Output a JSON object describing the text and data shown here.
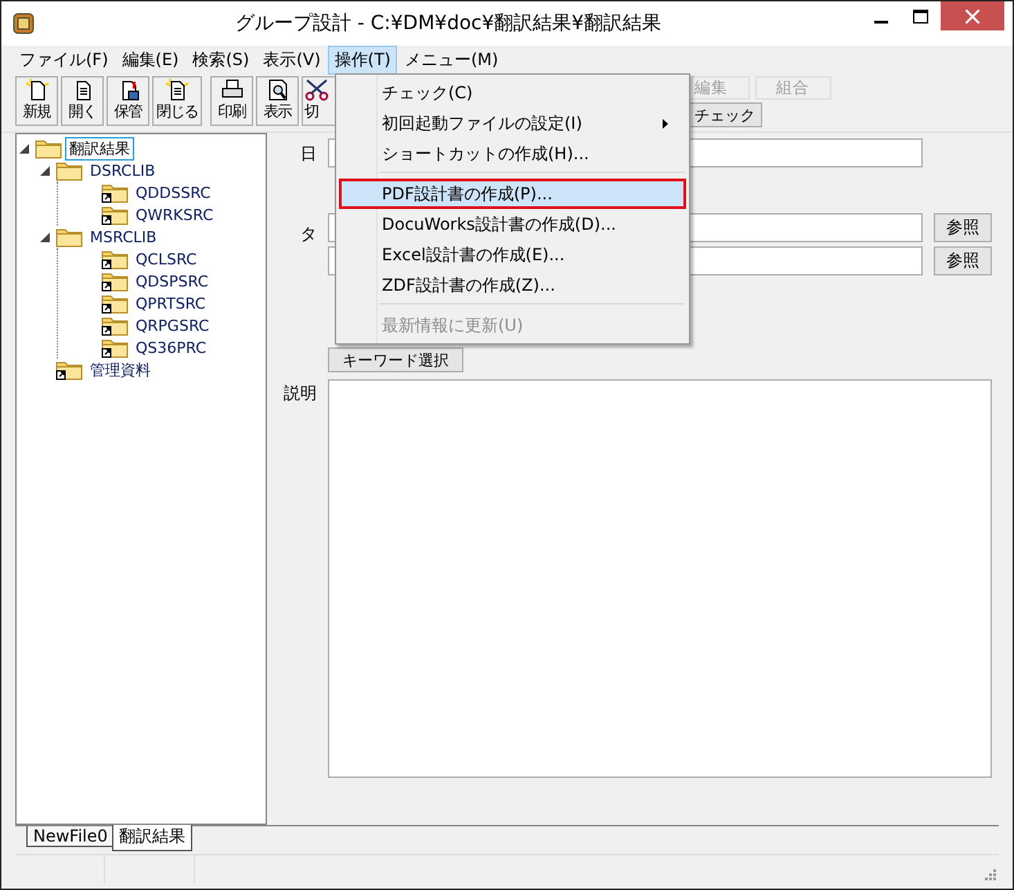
{
  "window": {
    "title": "グループ設計 - C:¥DM¥doc¥翻訳結果¥翻訳結果"
  },
  "menubar": [
    {
      "label": "ファイル(F)",
      "selected": false
    },
    {
      "label": "編集(E)",
      "selected": false
    },
    {
      "label": "検索(S)",
      "selected": false
    },
    {
      "label": "表示(V)",
      "selected": false
    },
    {
      "label": "操作(T)",
      "selected": true
    },
    {
      "label": "メニュー(M)",
      "selected": false
    }
  ],
  "toolbar": [
    {
      "label": "新規",
      "kind": "new"
    },
    {
      "label": "開く",
      "kind": "open"
    },
    {
      "label": "保管",
      "kind": "save"
    },
    {
      "label": "閉じる",
      "kind": "close"
    },
    {
      "label": "印刷",
      "kind": "print"
    },
    {
      "label": "表示",
      "kind": "view"
    },
    {
      "label": "切",
      "kind": "cut"
    }
  ],
  "toolbar_right": [
    {
      "label": "編集",
      "disabled": true
    },
    {
      "label": "組合",
      "disabled": true
    }
  ],
  "check_button": "チェック",
  "tree": [
    {
      "label": "翻訳結果",
      "selected": true,
      "kind": "folder",
      "expanded": true,
      "children": [
        {
          "label": "DSRCLIB",
          "selected": false,
          "kind": "folder",
          "expanded": true,
          "children": [
            {
              "label": "QDDSSRC",
              "selected": false,
              "kind": "link"
            },
            {
              "label": "QWRKSRC",
              "selected": false,
              "kind": "link"
            }
          ]
        },
        {
          "label": "MSRCLIB",
          "selected": false,
          "kind": "folder",
          "expanded": true,
          "children": [
            {
              "label": "QCLSRC",
              "selected": false,
              "kind": "link"
            },
            {
              "label": "QDSPSRC",
              "selected": false,
              "kind": "link"
            },
            {
              "label": "QPRTSRC",
              "selected": false,
              "kind": "link"
            },
            {
              "label": "QRPGSRC",
              "selected": false,
              "kind": "link"
            },
            {
              "label": "QS36PRC",
              "selected": false,
              "kind": "link"
            }
          ]
        },
        {
          "label": "管理資料",
          "selected": false,
          "kind": "link"
        }
      ]
    }
  ],
  "form": {
    "label_1": "日",
    "label_2": "タ",
    "browse_buttons": [
      "参照",
      "参照"
    ],
    "keyword_button": "キーワード選択",
    "description_label": "説明"
  },
  "menu": [
    {
      "label": "チェック(C)",
      "selected": false,
      "disabled": false,
      "submenu": false
    },
    {
      "label": "初回起動ファイルの設定(I)",
      "selected": false,
      "disabled": false,
      "submenu": true
    },
    {
      "label": "ショートカットの作成(H)...",
      "selected": false,
      "disabled": false,
      "submenu": false,
      "separator_after": true
    },
    {
      "label": "PDF設計書の作成(P)...",
      "selected": true,
      "disabled": false,
      "submenu": false
    },
    {
      "label": "DocuWorks設計書の作成(D)...",
      "selected": false,
      "disabled": false,
      "submenu": false
    },
    {
      "label": "Excel設計書の作成(E)...",
      "selected": false,
      "disabled": false,
      "submenu": false
    },
    {
      "label": "ZDF設計書の作成(Z)...",
      "selected": false,
      "disabled": false,
      "submenu": false,
      "separator_after": true
    },
    {
      "label": "最新情報に更新(U)",
      "selected": false,
      "disabled": true,
      "submenu": false
    }
  ],
  "file_tabs": [
    {
      "label": "NewFile0",
      "selected": false
    },
    {
      "label": "翻訳結果",
      "selected": true
    }
  ]
}
